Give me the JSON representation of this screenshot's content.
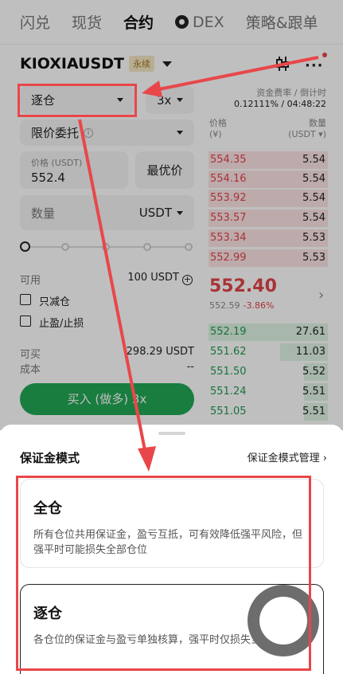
{
  "tabs": [
    {
      "label": "闪兑"
    },
    {
      "label": "现货"
    },
    {
      "label": "合约"
    },
    {
      "label": "DEX"
    },
    {
      "label": "策略&跟单"
    }
  ],
  "header": {
    "symbol": "KIOXIAUSDT",
    "badge": "永续"
  },
  "order_form": {
    "margin_mode": "逐仓",
    "leverage": "3x",
    "order_type": "限价委托",
    "order_type_info": "i",
    "price_label": "价格 (USDT)",
    "price_value": "552.4",
    "best_price_button": "最优价",
    "qty_label": "数量",
    "qty_unit": "USDT",
    "available_label": "可用",
    "available_value": "100 USDT",
    "reduce_only": "只减仓",
    "tp_sl": "止盈/止损",
    "can_buy_label": "可买",
    "can_buy_value": "298.29 USDT",
    "cost_label": "成本",
    "cost_value": "--",
    "buy_button": "买入 (做多) 3x"
  },
  "funding": {
    "label": "资金费率 / 倒计时",
    "value": "0.12111% / 04:48:22"
  },
  "orderbook": {
    "price_header": "价格",
    "price_unit": "(¥)",
    "qty_header": "数量",
    "qty_unit": "(USDT ▾)",
    "asks": [
      {
        "price": "554.35",
        "qty": "5.54",
        "depth": 1.0
      },
      {
        "price": "554.16",
        "qty": "5.54",
        "depth": 1.0
      },
      {
        "price": "553.92",
        "qty": "5.54",
        "depth": 1.0
      },
      {
        "price": "553.57",
        "qty": "5.54",
        "depth": 1.0
      },
      {
        "price": "553.34",
        "qty": "5.53",
        "depth": 1.0
      },
      {
        "price": "552.99",
        "qty": "5.53",
        "depth": 1.0
      }
    ],
    "last_price": "552.40",
    "mark_price": "552.59",
    "change": "-3.86%",
    "bids": [
      {
        "price": "552.19",
        "qty": "27.61",
        "depth": 1.0
      },
      {
        "price": "551.62",
        "qty": "11.03",
        "depth": 0.4
      },
      {
        "price": "551.50",
        "qty": "5.52",
        "depth": 0.2
      },
      {
        "price": "551.24",
        "qty": "5.51",
        "depth": 0.2
      },
      {
        "price": "551.05",
        "qty": "5.51",
        "depth": 0.2
      }
    ]
  },
  "sheet": {
    "title": "保证金模式",
    "manage_link": "保证金模式管理",
    "options": [
      {
        "title": "全仓",
        "desc": "所有仓位共用保证金，盈亏互抵，可有效降低强平风险，但强平时可能损失全部仓位"
      },
      {
        "title": "逐仓",
        "desc": "各仓位的保证金与盈亏单独核算，强平时仅损失当前仓位"
      }
    ]
  },
  "colors": {
    "ask": "#e0444a",
    "bid": "#1f9a4e",
    "buy": "#22a755",
    "annotation": "#e8474a"
  }
}
